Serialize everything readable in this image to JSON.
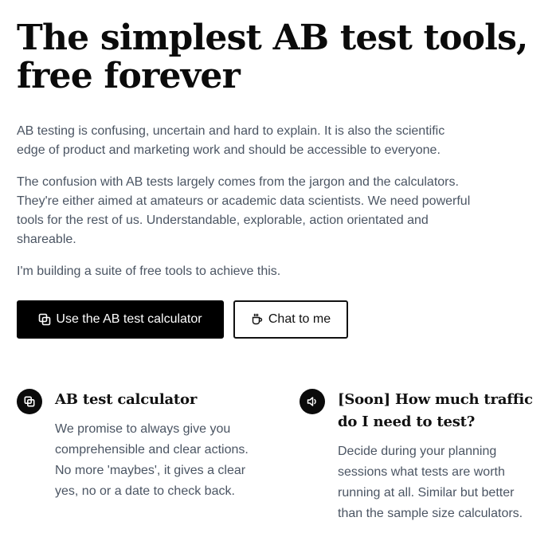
{
  "hero": {
    "title": "The simplest AB test tools, free forever",
    "paragraphs": [
      "AB testing is confusing, uncertain and hard to explain. It is also the scientific edge of product and marketing work and should be accessible to everyone.",
      "The confusion with AB tests largely comes from the jargon and the calculators. They're either aimed at amateurs or academic data scientists. We need powerful tools for the rest of us. Understandable, explorable, action orientated and shareable.",
      "I'm building a suite of free tools to achieve this."
    ]
  },
  "actions": {
    "primary": {
      "label": "Use the AB test calculator",
      "icon": "copy-squares-icon"
    },
    "secondary": {
      "label": "Chat to me",
      "icon": "coffee-cup-icon"
    }
  },
  "features": [
    {
      "icon": "copy-squares-icon",
      "title": "AB test calculator",
      "description": "We promise to always give you comprehensible and clear actions. No more 'maybes', it gives a clear yes, no or a date to check back."
    },
    {
      "icon": "speaker-icon",
      "title": "[Soon] How much traffic do I need to test?",
      "description": "Decide during your planning sessions what tests are worth running at all. Similar but better than the sample size calculators."
    }
  ],
  "colors": {
    "text_primary": "#0b0b0b",
    "text_body": "#4b5563",
    "button_primary_bg": "#000000",
    "button_primary_text": "#ffffff",
    "badge_bg": "#0b0b0b"
  }
}
